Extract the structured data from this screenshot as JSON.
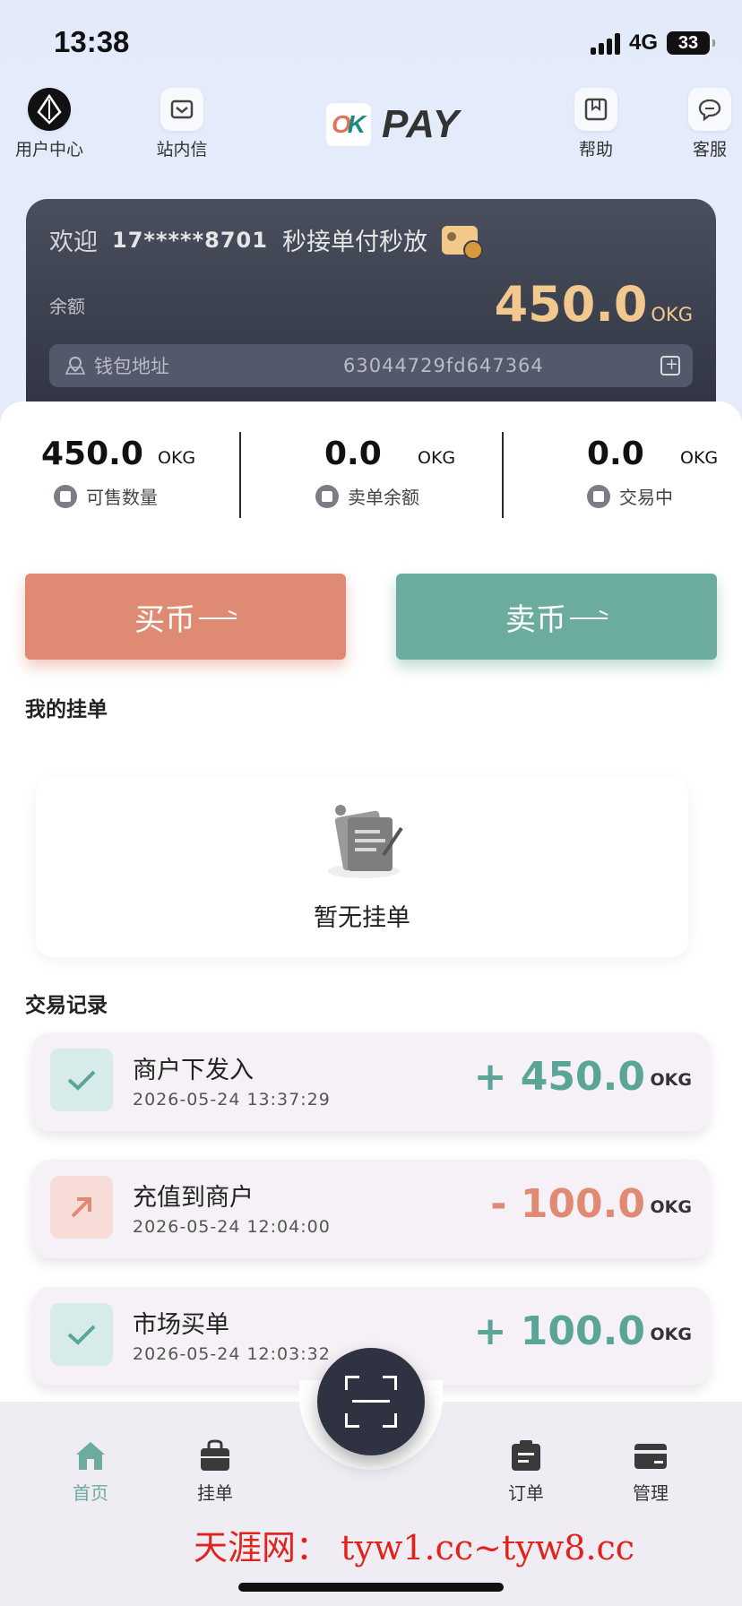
{
  "status": {
    "time": "13:38",
    "network": "4G",
    "battery": "33"
  },
  "nav": {
    "user_center": "用户中心",
    "messages": "站内信",
    "brand": "PAY",
    "help": "帮助",
    "service": "客服"
  },
  "wallet": {
    "welcome": "欢迎",
    "phone": "17*****8701",
    "slogan": "秒接单付秒放",
    "balance_label": "余额",
    "balance": "450.0",
    "unit": "OKG",
    "address_label": "钱包地址",
    "address": "63044729fd647364"
  },
  "stats": [
    {
      "value": "450.0",
      "unit": "OKG",
      "label": "可售数量"
    },
    {
      "value": "0.0",
      "unit": "OKG",
      "label": "卖单余额"
    },
    {
      "value": "0.0",
      "unit": "OKG",
      "label": "交易中"
    }
  ],
  "actions": {
    "buy": "买币",
    "sell": "卖币"
  },
  "my_orders": {
    "title": "我的挂单",
    "empty": "暂无挂单"
  },
  "transactions": {
    "title": "交易记录",
    "items": [
      {
        "title": "商户下发入",
        "time": "2026-05-24 13:37:29",
        "amount": "+ 450.0",
        "unit": "OKG",
        "type": "in"
      },
      {
        "title": "充值到商户",
        "time": "2026-05-24 12:04:00",
        "amount": "- 100.0",
        "unit": "OKG",
        "type": "out"
      },
      {
        "title": "市场买单",
        "time": "2026-05-24 12:03:32",
        "amount": "+ 100.0",
        "unit": "OKG",
        "type": "in"
      }
    ]
  },
  "tabbar": {
    "home": "首页",
    "listing": "挂单",
    "orders": "订单",
    "manage": "管理"
  },
  "watermark": "天涯网： tyw1.cc~tyw8.cc",
  "colors": {
    "buy": "#df8a73",
    "sell": "#6bac9e",
    "gold": "#f3c88f",
    "dark_card": "#2e3240"
  }
}
